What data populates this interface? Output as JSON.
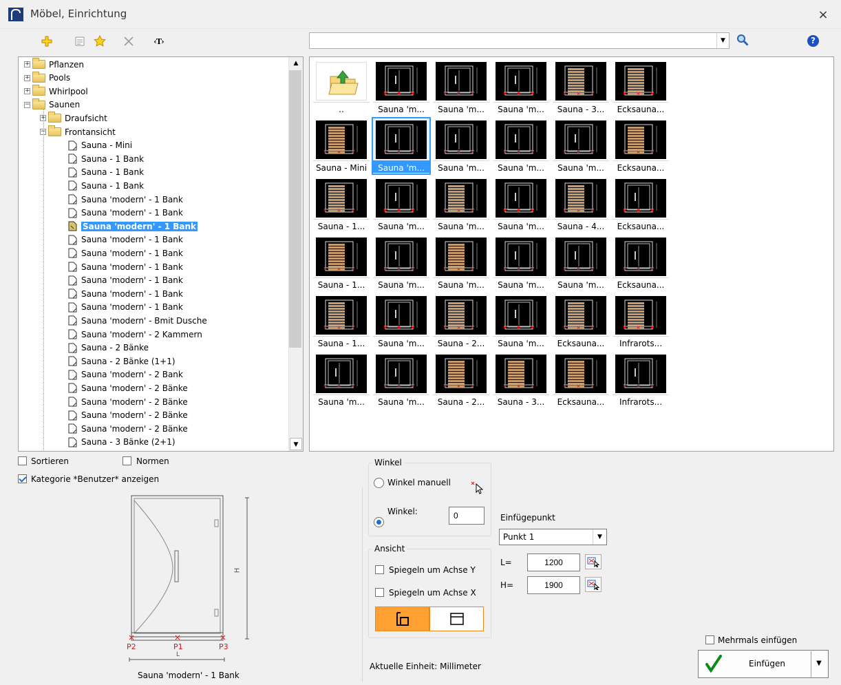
{
  "window": {
    "title": "Möbel, Einrichtung",
    "close_glyph": "×"
  },
  "toolbar": {
    "buttons": [
      "add-icon",
      "details-view-icon",
      "favorite-star-icon",
      "delete-icon",
      "text-tag-icon"
    ],
    "text_tag": "‹T›",
    "help": "?"
  },
  "search": {
    "value": "",
    "placeholder": ""
  },
  "tree": [
    {
      "label": "Pflanzen",
      "level": 0,
      "kind": "folder",
      "expander": "+"
    },
    {
      "label": "Pools",
      "level": 0,
      "kind": "folder",
      "expander": "+"
    },
    {
      "label": "Whirlpool",
      "level": 0,
      "kind": "folder",
      "expander": "+"
    },
    {
      "label": "Saunen",
      "level": 0,
      "kind": "folder",
      "expander": "−"
    },
    {
      "label": "Draufsicht",
      "level": 1,
      "kind": "folder",
      "expander": "+"
    },
    {
      "label": "Frontansicht",
      "level": 1,
      "kind": "folder",
      "expander": "−"
    },
    {
      "label": "Sauna - Mini",
      "level": 2,
      "kind": "doc"
    },
    {
      "label": "Sauna - 1 Bank",
      "level": 2,
      "kind": "doc"
    },
    {
      "label": "Sauna - 1 Bank",
      "level": 2,
      "kind": "doc"
    },
    {
      "label": "Sauna - 1 Bank",
      "level": 2,
      "kind": "doc"
    },
    {
      "label": "Sauna 'modern' - 1 Bank",
      "level": 2,
      "kind": "doc"
    },
    {
      "label": "Sauna 'modern' - 1 Bank",
      "level": 2,
      "kind": "doc"
    },
    {
      "label": "Sauna 'modern' - 1 Bank",
      "level": 2,
      "kind": "doc",
      "selected": true
    },
    {
      "label": "Sauna 'modern' - 1 Bank",
      "level": 2,
      "kind": "doc"
    },
    {
      "label": "Sauna 'modern' - 1 Bank",
      "level": 2,
      "kind": "doc"
    },
    {
      "label": "Sauna 'modern' - 1 Bank",
      "level": 2,
      "kind": "doc"
    },
    {
      "label": "Sauna 'modern' - 1 Bank",
      "level": 2,
      "kind": "doc"
    },
    {
      "label": "Sauna 'modern' - 1 Bank",
      "level": 2,
      "kind": "doc"
    },
    {
      "label": "Sauna 'modern' - 1 Bank",
      "level": 2,
      "kind": "doc"
    },
    {
      "label": "Sauna 'modern' - Bmit Dusche",
      "level": 2,
      "kind": "doc"
    },
    {
      "label": "Sauna 'modern' - 2 Kammern",
      "level": 2,
      "kind": "doc"
    },
    {
      "label": "Sauna - 2 Bänke",
      "level": 2,
      "kind": "doc"
    },
    {
      "label": "Sauna - 2 Bänke (1+1)",
      "level": 2,
      "kind": "doc"
    },
    {
      "label": "Sauna 'modern' - 2 Bank",
      "level": 2,
      "kind": "doc"
    },
    {
      "label": "Sauna 'modern' - 2 Bänke",
      "level": 2,
      "kind": "doc"
    },
    {
      "label": "Sauna 'modern' - 2 Bänke",
      "level": 2,
      "kind": "doc"
    },
    {
      "label": "Sauna 'modern' - 2 Bänke",
      "level": 2,
      "kind": "doc"
    },
    {
      "label": "Sauna 'modern' - 2 Bänke",
      "level": 2,
      "kind": "doc"
    },
    {
      "label": "Sauna - 3 Bänke (2+1)",
      "level": 2,
      "kind": "doc"
    }
  ],
  "scroll": {
    "up": "▲",
    "down": "▼"
  },
  "grid": [
    [
      {
        "cap": "..",
        "folder": true
      },
      {
        "cap": "Sauna 'm..."
      },
      {
        "cap": "Sauna 'm..."
      },
      {
        "cap": "Sauna 'm..."
      },
      {
        "cap": "Sauna - 3...",
        "style": "wood"
      },
      {
        "cap": "Ecksauna...",
        "style": "wood"
      }
    ],
    [
      {
        "cap": "Sauna - Mini",
        "style": "wood"
      },
      {
        "cap": "Sauna 'm...",
        "selected": true
      },
      {
        "cap": "Sauna 'm..."
      },
      {
        "cap": "Sauna 'm..."
      },
      {
        "cap": "Sauna 'm..."
      },
      {
        "cap": "Ecksauna...",
        "style": "wood"
      }
    ],
    [
      {
        "cap": "Sauna - 1...",
        "style": "wood"
      },
      {
        "cap": "Sauna 'm..."
      },
      {
        "cap": "Sauna 'm...",
        "style": "wood"
      },
      {
        "cap": "Sauna 'm..."
      },
      {
        "cap": "Sauna - 4...",
        "style": "wood"
      },
      {
        "cap": "Ecksauna..."
      }
    ],
    [
      {
        "cap": "Sauna - 1...",
        "style": "wood"
      },
      {
        "cap": "Sauna 'm..."
      },
      {
        "cap": "Sauna 'm...",
        "style": "wood"
      },
      {
        "cap": "Sauna 'm..."
      },
      {
        "cap": "Sauna 'm..."
      },
      {
        "cap": "Ecksauna..."
      }
    ],
    [
      {
        "cap": "Sauna - 1...",
        "style": "wood"
      },
      {
        "cap": "Sauna 'm..."
      },
      {
        "cap": "Sauna - 2...",
        "style": "wood"
      },
      {
        "cap": "Sauna 'm..."
      },
      {
        "cap": "Ecksauna...",
        "style": "wood"
      },
      {
        "cap": "Infrarots...",
        "style": "wood"
      }
    ],
    [
      {
        "cap": "Sauna 'm..."
      },
      {
        "cap": "Sauna 'm..."
      },
      {
        "cap": "Sauna - 2...",
        "style": "wood"
      },
      {
        "cap": "Sauna - 3...",
        "style": "wood"
      },
      {
        "cap": "Ecksauna...",
        "style": "wood"
      },
      {
        "cap": "Infrarots..."
      }
    ]
  ],
  "options": {
    "sort": "Sortieren",
    "norms": "Normen",
    "show_user_category": "Kategorie *Benutzer* anzeigen"
  },
  "preview": {
    "caption": "Sauna 'modern' - 1 Bank",
    "p1": "P1",
    "p2": "P2",
    "p3": "P3",
    "l": "L",
    "h": "H"
  },
  "angle": {
    "legend": "Winkel",
    "manual": "Winkel manuell",
    "fixed": "Winkel:",
    "value": "0"
  },
  "view": {
    "legend": "Ansicht",
    "mirror_y": "Spiegeln um Achse Y",
    "mirror_x": "Spiegeln um Achse X"
  },
  "insert_point": {
    "label": "Einfügepunkt",
    "value": "Punkt 1",
    "l_label": "L=",
    "l_value": "1200",
    "h_label": "H=",
    "h_value": "1900"
  },
  "unit_text": "Aktuelle Einheit: Millimeter",
  "multi_insert": "Mehrmals einfügen",
  "insert_button": "Einfügen",
  "colors": {
    "accent": "#3399ff",
    "orange": "#ffa033",
    "marker": "#e01010",
    "wood": "#c89c6a"
  }
}
